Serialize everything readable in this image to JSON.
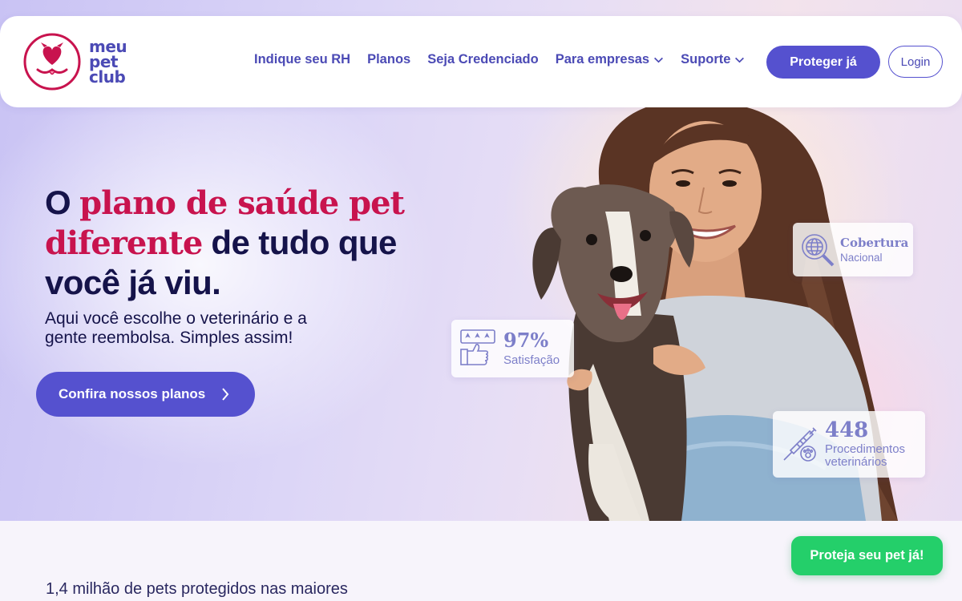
{
  "brand": {
    "logo_lines": [
      "meu",
      "pet",
      "club"
    ],
    "colors": {
      "primary": "#5551cf",
      "accent": "#c8134e",
      "green": "#24cf6a",
      "text": "#15134a"
    }
  },
  "nav": {
    "items": [
      {
        "label": "Indique seu RH",
        "dropdown": false
      },
      {
        "label": "Planos",
        "dropdown": false
      },
      {
        "label": "Seja Credenciado",
        "dropdown": false
      },
      {
        "label": "Para empresas",
        "dropdown": true
      },
      {
        "label": "Suporte",
        "dropdown": true
      }
    ],
    "protect_label": "Proteger já",
    "login_label": "Login"
  },
  "hero": {
    "headline_prefix": "O ",
    "headline_accent": "plano de saúde pet diferente",
    "headline_suffix": " de tudo que você já viu.",
    "subtext": "Aqui você escolhe o veterinário e a gente reembolsa. Simples assim!",
    "cta_label": "Confira nossos planos"
  },
  "stats": {
    "satisfaction": {
      "value": "97%",
      "label": "Satisfação",
      "icon": "thumbs-up-rating-icon"
    },
    "coverage": {
      "value": "Cobertura",
      "label": "Nacional",
      "icon": "globe-search-icon"
    },
    "procedures": {
      "value": "448",
      "label": "Procedimentos veterinários",
      "icon": "syringe-paw-icon"
    }
  },
  "lower": {
    "text": "1,4 milhão de pets protegidos nas maiores",
    "floating_button": "Proteja seu pet já!"
  }
}
